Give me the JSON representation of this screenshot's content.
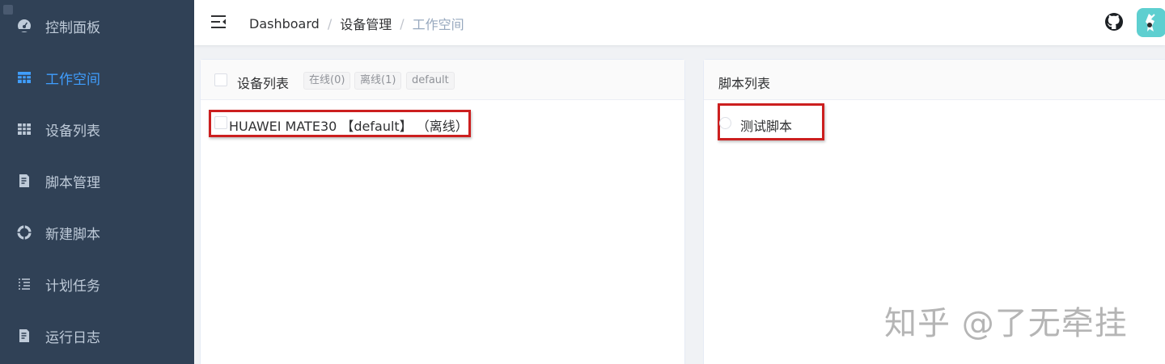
{
  "sidebar": {
    "items": [
      {
        "label": "控制面板",
        "icon": "dashboard-icon"
      },
      {
        "label": "工作空间",
        "icon": "grid-icon",
        "active": true
      },
      {
        "label": "设备列表",
        "icon": "table-icon"
      },
      {
        "label": "脚本管理",
        "icon": "document-icon"
      },
      {
        "label": "新建脚本",
        "icon": "lifebuoy-icon"
      },
      {
        "label": "计划任务",
        "icon": "list-icon"
      },
      {
        "label": "运行日志",
        "icon": "log-icon"
      }
    ],
    "background": "#304156",
    "active_color": "#409eff"
  },
  "header": {
    "breadcrumb": [
      "Dashboard",
      "设备管理",
      "工作空间"
    ],
    "separator": "/"
  },
  "device_panel": {
    "title": "设备列表",
    "tags": [
      "在线(0)",
      "离线(1)",
      "default"
    ],
    "devices": [
      {
        "text": "HUAWEI MATE30 【default】 （离线）",
        "checked": false
      }
    ]
  },
  "script_panel": {
    "title": "脚本列表",
    "scripts": [
      {
        "label": "测试脚本",
        "selected": false
      }
    ]
  },
  "watermark": "知乎 @了无牵挂"
}
